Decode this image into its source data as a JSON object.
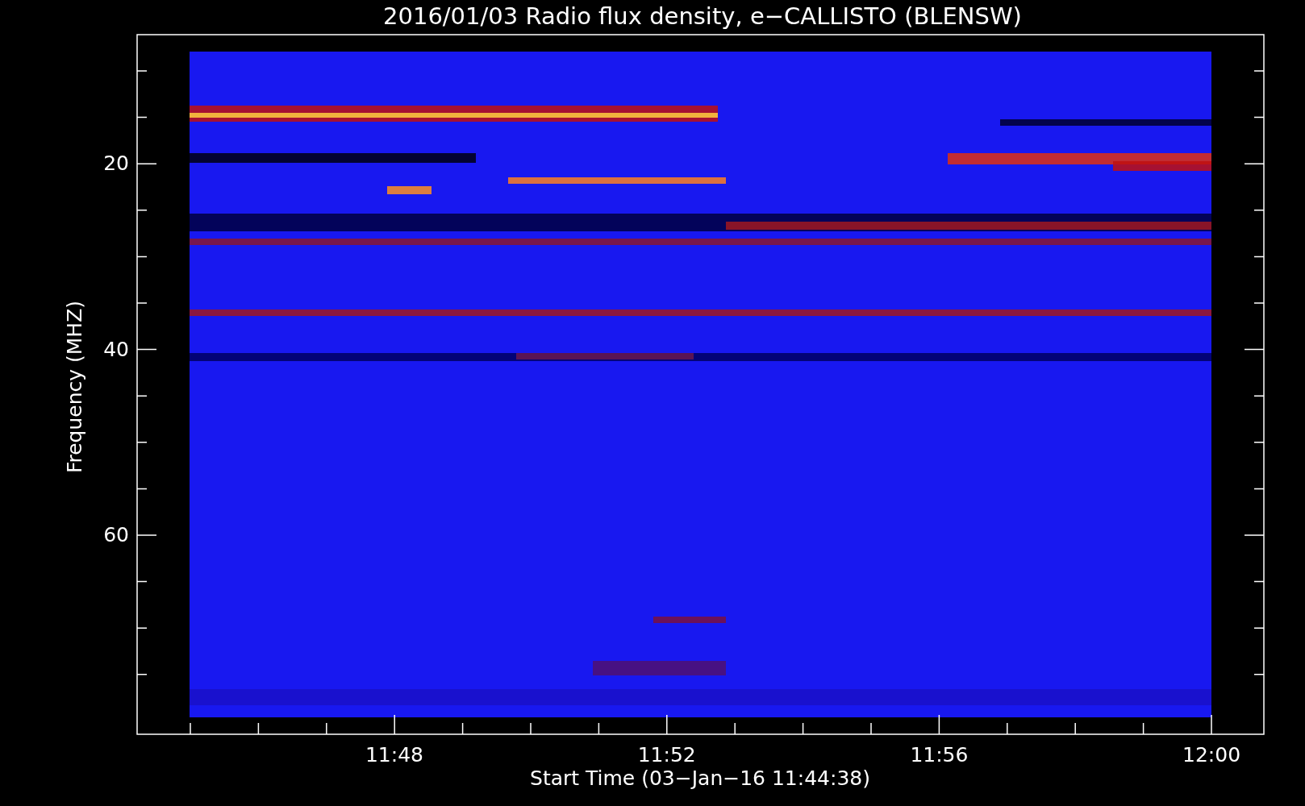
{
  "title": "2016/01/03  Radio flux density, e−CALLISTO (BLENSW)",
  "y_axis": {
    "label": "Frequency (MHZ)",
    "ticks": [
      "20",
      "40",
      "60"
    ]
  },
  "x_axis": {
    "label": "Start Time (03−Jan−16 11:44:38)",
    "ticks": [
      "11:48",
      "11:52",
      "11:56",
      "12:00"
    ]
  }
}
